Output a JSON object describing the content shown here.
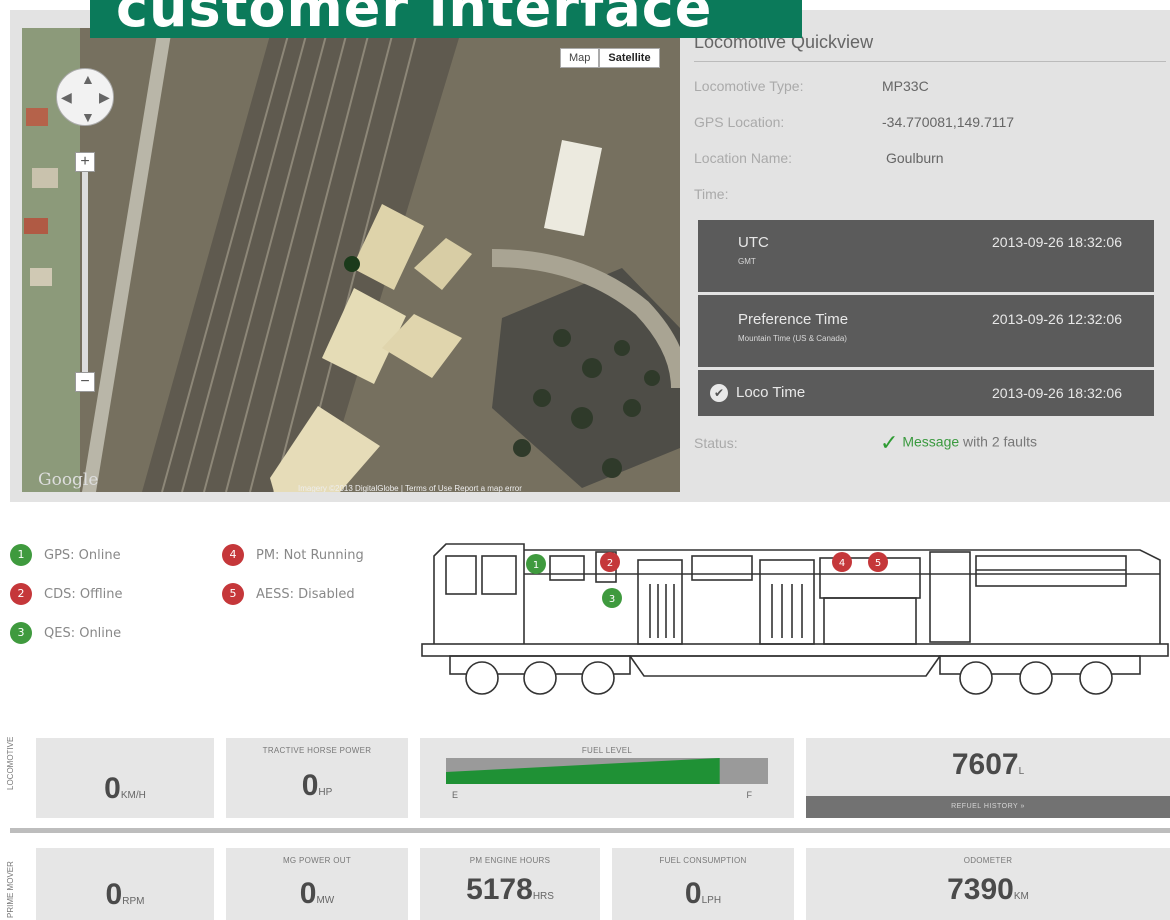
{
  "banner": {
    "text": "customer interface"
  },
  "map": {
    "type_buttons": [
      "Map",
      "Satellite"
    ],
    "active_type": "Satellite",
    "logo": "Google",
    "footer": "Imagery ©2013 DigitalGlobe  |  Terms of Use   Report a map error",
    "zoom_in": "+",
    "zoom_out": "−"
  },
  "quickview": {
    "title": "Locomotive Quickview",
    "type_label": "Locomotive Type:",
    "type_value": "MP33C",
    "gps_label": "GPS Location:",
    "gps_value": "-34.770081,149.7117",
    "location_label": "Location Name:",
    "location_value": "Goulburn",
    "time_label": "Time:",
    "times": {
      "utc": {
        "label": "UTC",
        "sub": "GMT",
        "value": "2013-09-26 18:32:06"
      },
      "preference": {
        "label": "Preference Time",
        "sub": "Mountain Time (US & Canada)",
        "value": "2013-09-26 12:32:06"
      },
      "loco": {
        "label": "Loco Time",
        "value": "2013-09-26 18:32:06"
      }
    },
    "status_label": "Status:",
    "status_link": "Message",
    "status_rest": " with 2 faults"
  },
  "legend": {
    "left": [
      {
        "num": "1",
        "text": "GPS: Online",
        "state": "green"
      },
      {
        "num": "2",
        "text": "CDS: Offline",
        "state": "red"
      },
      {
        "num": "3",
        "text": "QES: Online",
        "state": "green"
      }
    ],
    "right": [
      {
        "num": "4",
        "text": "PM: Not Running",
        "state": "red"
      },
      {
        "num": "5",
        "text": "AESS: Disabled",
        "state": "red"
      }
    ]
  },
  "locomotive_row": {
    "side_label": "LOCOMOTIVE",
    "speed": {
      "value": "0",
      "unit": "KM/H"
    },
    "tractive": {
      "caption": "TRACTIVE HORSE POWER",
      "value": "0",
      "unit": "HP"
    },
    "fuel": {
      "caption": "FUEL LEVEL",
      "level": 0.85,
      "empty": "E",
      "full": "F"
    },
    "fuel_litres": {
      "value": "7607",
      "unit": "L",
      "button": "REFUEL HISTORY »"
    }
  },
  "prime_mover_row": {
    "side_label": "PRIME MOVER",
    "rpm": {
      "value": "0",
      "unit": "RPM"
    },
    "mg_power": {
      "caption": "MG POWER OUT",
      "value": "0",
      "unit": "MW"
    },
    "engine_hours": {
      "caption": "PM ENGINE HOURS",
      "value": "5178",
      "unit": "HRS"
    },
    "fuel_consumption": {
      "caption": "FUEL CONSUMPTION",
      "value": "0",
      "unit": "LPH"
    },
    "odometer": {
      "caption": "ODOMETER",
      "value": "7390",
      "unit": "KM"
    }
  },
  "colors": {
    "brand": "#0b7a5a",
    "online": "#3f9a3e",
    "fault": "#c5373a",
    "fuel": "#1f9135"
  }
}
